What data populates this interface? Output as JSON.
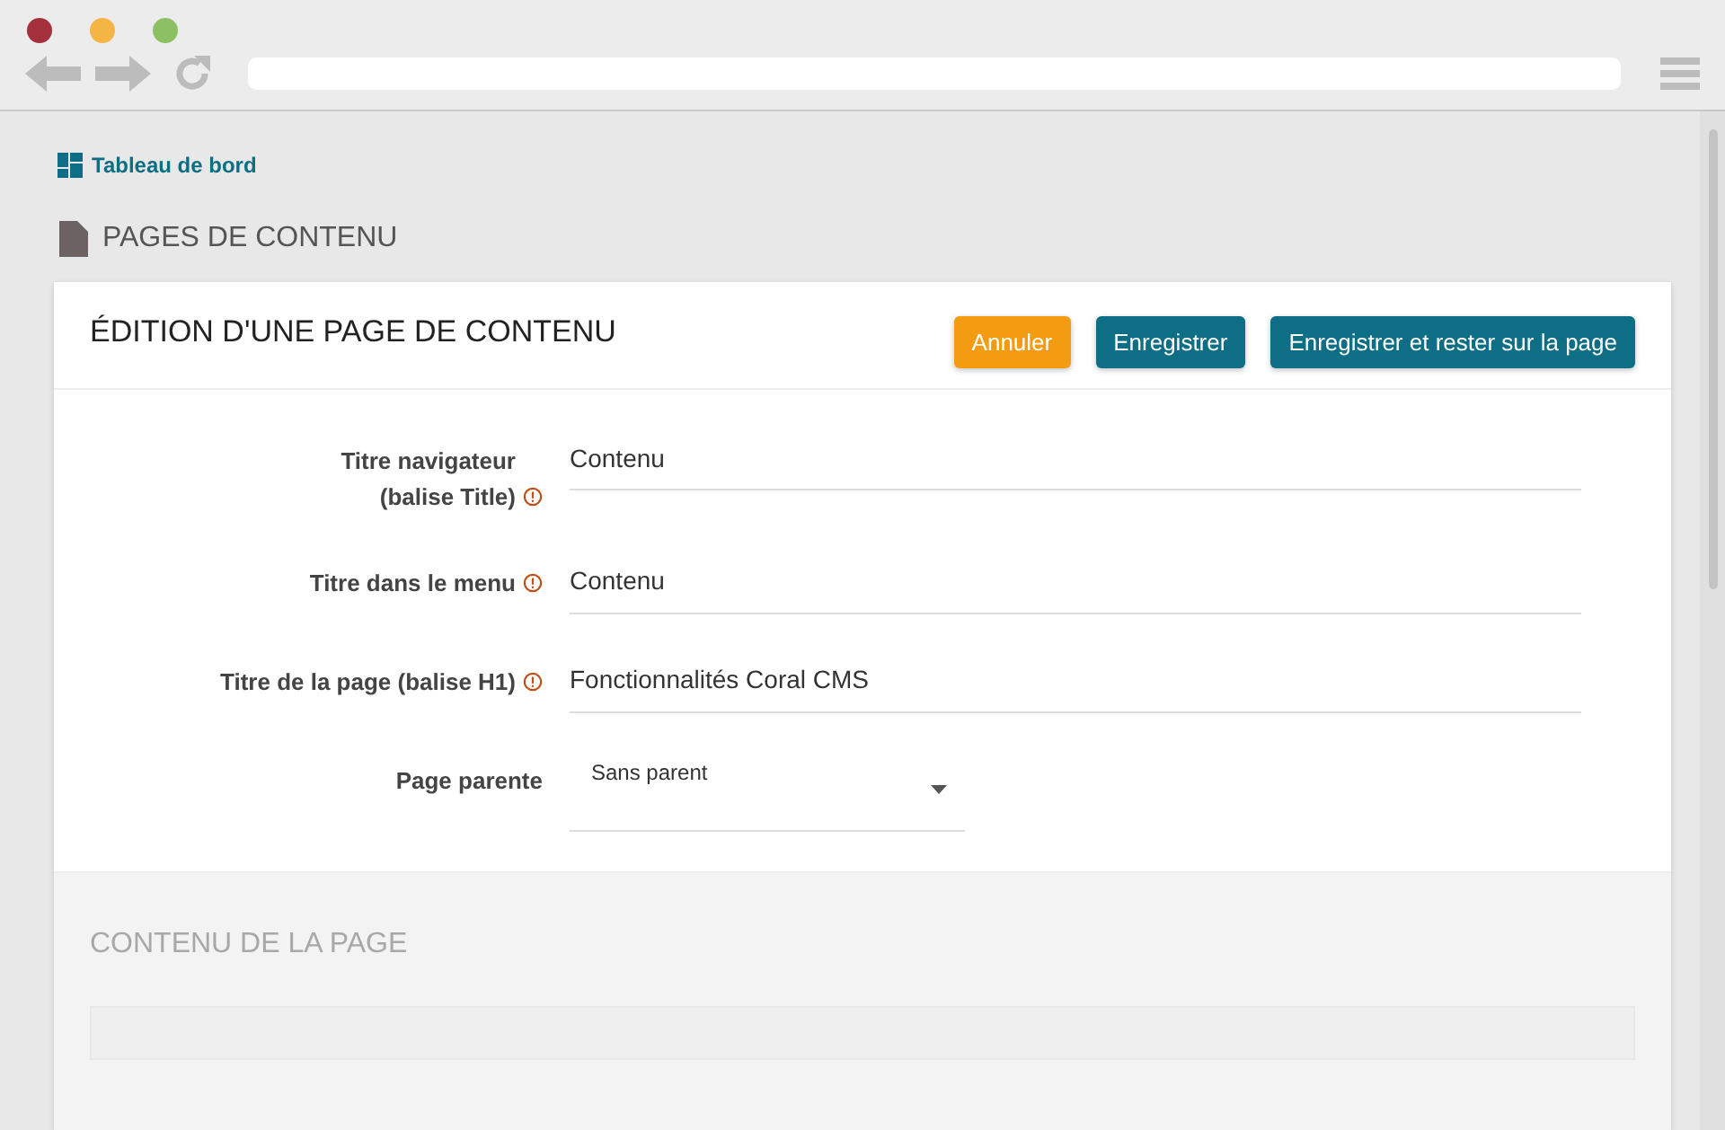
{
  "breadcrumb": "Tableau de bord",
  "section_title": "PAGES DE CONTENU",
  "card": {
    "title": "ÉDITION D'UNE PAGE DE CONTENU",
    "buttons": [
      {
        "label": "Annuler",
        "kind": "cancel"
      },
      {
        "label": "Enregistrer",
        "kind": "primary"
      },
      {
        "label": "Enregistrer et rester sur la page",
        "kind": "primary"
      }
    ],
    "fields": [
      {
        "label_lines": [
          "Titre navigateur",
          "(balise Title)"
        ],
        "required": true,
        "kind": "text",
        "value": "Contenu"
      },
      {
        "label_lines": [
          "Titre dans le menu"
        ],
        "required": true,
        "kind": "text",
        "value": "Contenu"
      },
      {
        "label_lines": [
          "Titre de la page (balise H1)"
        ],
        "required": true,
        "kind": "text",
        "value": "Fonctionnalités Coral CMS"
      },
      {
        "label_lines": [
          "Page parente"
        ],
        "required": false,
        "kind": "select",
        "value": "Sans parent"
      }
    ]
  },
  "content_section": {
    "title": "CONTENU DE LA PAGE"
  }
}
